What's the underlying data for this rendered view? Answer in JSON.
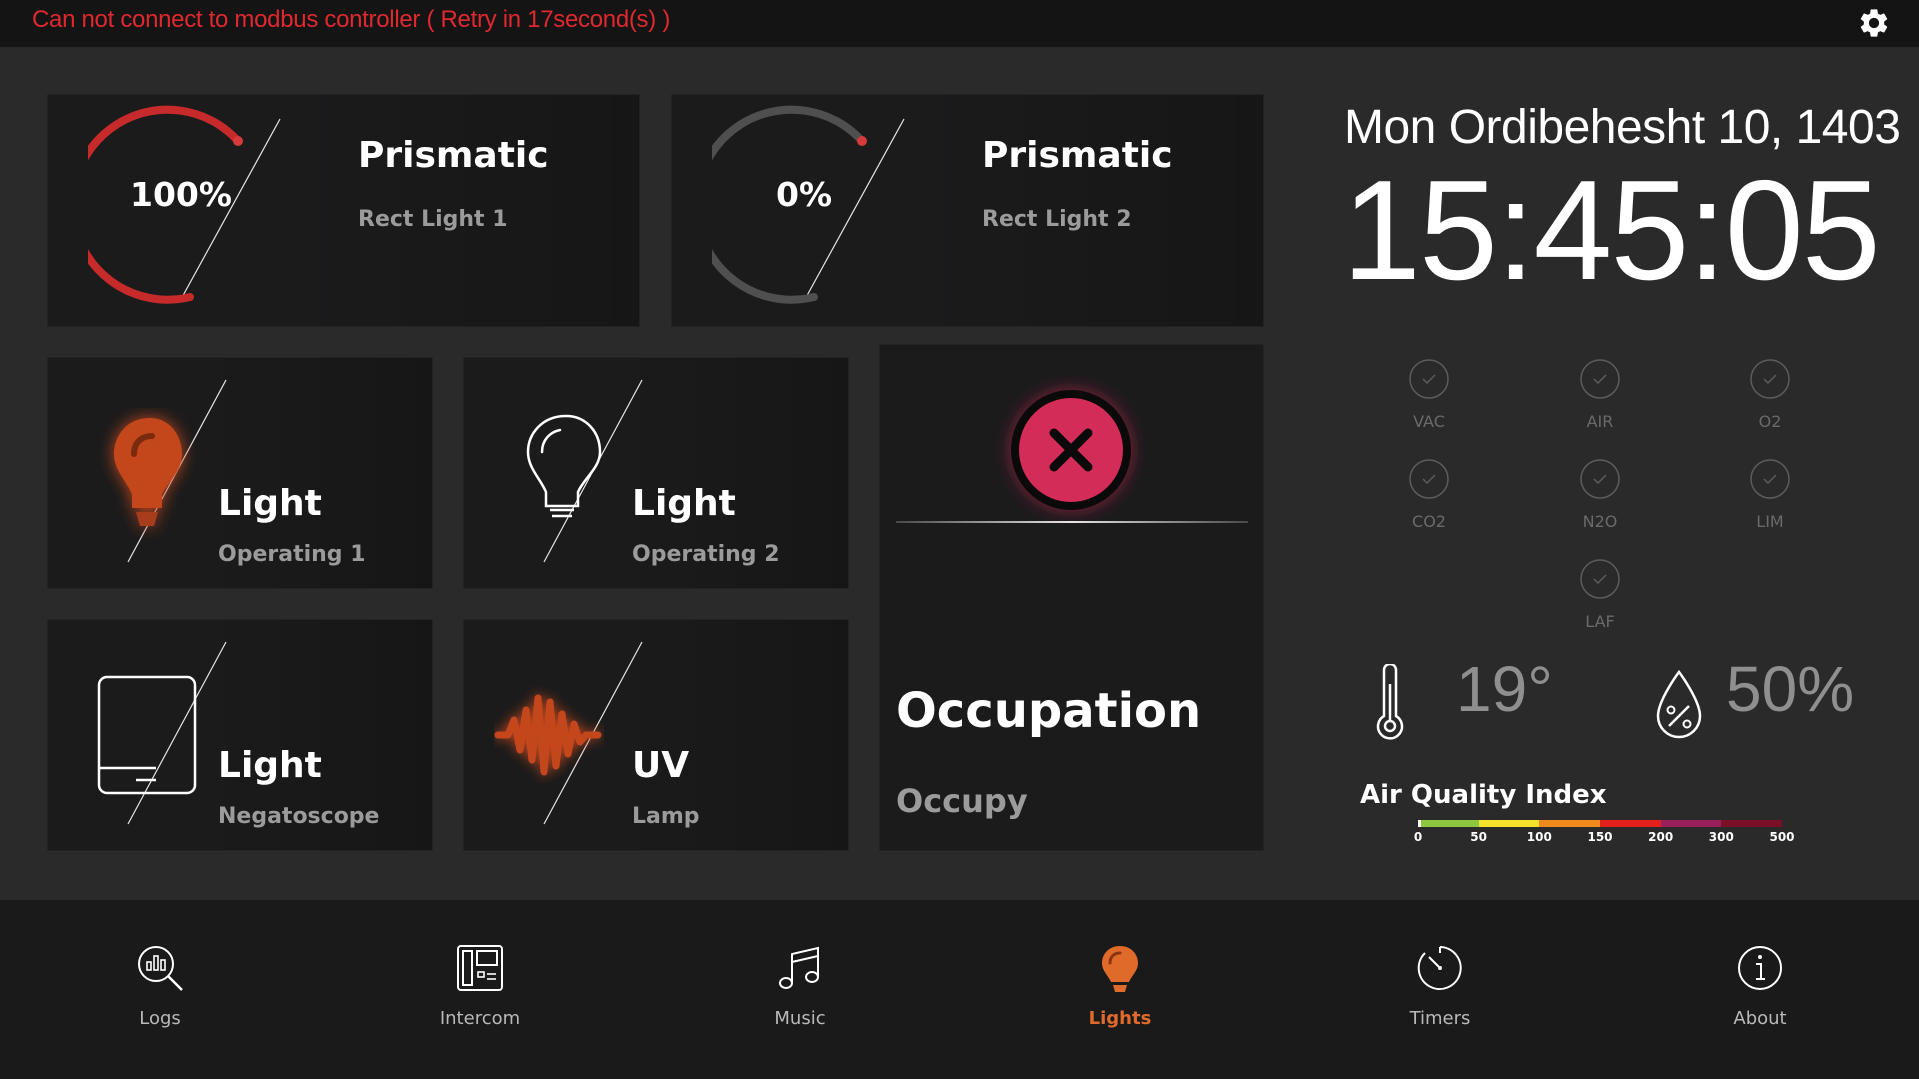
{
  "status_bar": {
    "error_message": "Can not connect to modbus controller ( Retry in 17second(s) )"
  },
  "prismatic_lights": [
    {
      "title": "Prismatic",
      "subtitle": "Rect Light 1",
      "level_text": "100%",
      "level_fraction": 1.0,
      "color": "#c62a2a"
    },
    {
      "title": "Prismatic",
      "subtitle": "Rect Light 2",
      "level_text": "0%",
      "level_fraction": 0.0,
      "color": "#4a4a4a"
    }
  ],
  "light_tiles": [
    {
      "title": "Light",
      "subtitle": "Operating 1",
      "icon": "bulb-on-icon",
      "state": "on"
    },
    {
      "title": "Light",
      "subtitle": "Operating 2",
      "icon": "bulb-off-icon",
      "state": "off"
    },
    {
      "title": "Light",
      "subtitle": "Negatoscope",
      "icon": "negatoscope-icon",
      "state": "off"
    },
    {
      "title": "UV",
      "subtitle": "Lamp",
      "icon": "uv-wave-icon",
      "state": "on"
    }
  ],
  "occupation": {
    "title": "Occupation",
    "subtitle": "Occupy",
    "icon": "close-x-icon",
    "accent": "#c8234e"
  },
  "datetime": {
    "date": "Mon Ordibehesht 10, 1403",
    "time": "15:45:05"
  },
  "gas_status": [
    {
      "label": "VAC",
      "icon": "check-circle-icon"
    },
    {
      "label": "AIR",
      "icon": "check-circle-icon"
    },
    {
      "label": "O2",
      "icon": "check-circle-icon"
    },
    {
      "label": "CO2",
      "icon": "check-circle-icon"
    },
    {
      "label": "N2O",
      "icon": "check-circle-icon"
    },
    {
      "label": "LIM",
      "icon": "check-circle-icon"
    },
    {
      "label": "LAF",
      "icon": "check-circle-icon"
    }
  ],
  "environment": {
    "temperature": "19°",
    "humidity": "50%"
  },
  "air_quality": {
    "title": "Air Quality Index",
    "ticks": [
      "0",
      "50",
      "100",
      "150",
      "200",
      "300",
      "500"
    ],
    "colors": [
      "#8dc63f",
      "#f5e12a",
      "#f08a1c",
      "#e3201b",
      "#9b1f5a",
      "#7a1028"
    ]
  },
  "nav": [
    {
      "label": "Logs",
      "icon": "logs-search-icon",
      "active": false
    },
    {
      "label": "Intercom",
      "icon": "intercom-icon",
      "active": false
    },
    {
      "label": "Music",
      "icon": "music-note-icon",
      "active": false
    },
    {
      "label": "Lights",
      "icon": "bulb-icon",
      "active": true
    },
    {
      "label": "Timers",
      "icon": "timer-icon",
      "active": false
    },
    {
      "label": "About",
      "icon": "info-icon",
      "active": false
    }
  ],
  "colors": {
    "accent_orange": "#e06a2a",
    "error_red": "#e0282f"
  }
}
